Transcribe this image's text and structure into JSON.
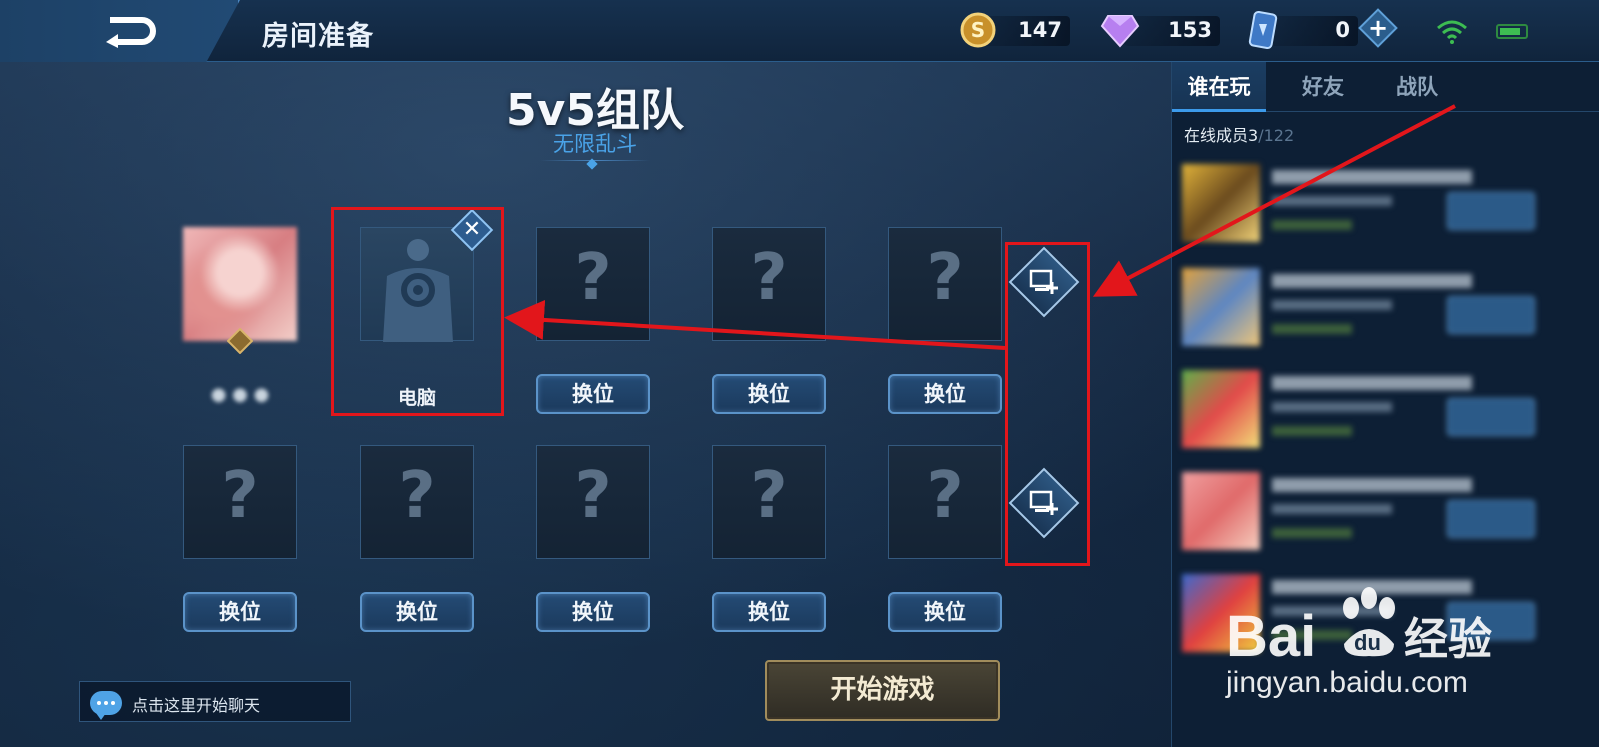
{
  "header": {
    "room_title": "房间准备",
    "currencies": [
      {
        "icon": "gold-coin-icon",
        "amount": "147"
      },
      {
        "icon": "diamond-gem-icon",
        "amount": "153"
      },
      {
        "icon": "voucher-card-icon",
        "amount": "0"
      }
    ],
    "add_label": "+"
  },
  "mode": {
    "title": "5v5组队",
    "subtitle": "无限乱斗"
  },
  "team_top": {
    "slot2_label": "电脑",
    "swap_label": "换位",
    "remove_label": "✕"
  },
  "slot_placeholder": "?",
  "chat": {
    "placeholder": "点击这里开始聊天"
  },
  "start_button": "开始游戏",
  "side_panel": {
    "tabs": [
      "谁在玩",
      "好友",
      "战队"
    ],
    "active_tab": "谁在玩",
    "online_label": "在线成员3",
    "online_total": "/122"
  },
  "watermark": {
    "url": "jingyan.baidu.com"
  },
  "colors": {
    "annotation_red": "#e2161b",
    "accent_blue": "#4aa3e8",
    "start_gold": "#a08c5c"
  }
}
